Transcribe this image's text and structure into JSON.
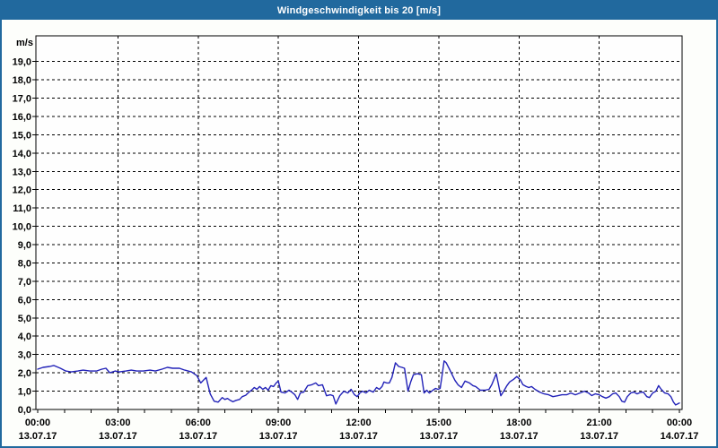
{
  "window": {
    "title_bar": {
      "label": "Windgeschwindigkeit bis 20 [m/s]",
      "bg_color": "#21699e",
      "text_color": "#ffffff"
    },
    "border_color": "#21699e",
    "background_color": "#fdfefb"
  },
  "chart_data": {
    "type": "line",
    "title": "Windgeschwindigkeit bis 20 [m/s]",
    "ylabel": "m/s",
    "ylim": [
      0,
      20.4
    ],
    "grid": "dashed",
    "gridline_color": "#000000",
    "plot_bg": "#fefefe",
    "legend": "none",
    "ytick_labels": [
      "0,0",
      "1,0",
      "2,0",
      "3,0",
      "4,0",
      "5,0",
      "6,0",
      "7,0",
      "8,0",
      "9,0",
      "10,0",
      "11,0",
      "12,0",
      "13,0",
      "14,0",
      "15,0",
      "16,0",
      "17,0",
      "18,0",
      "19,0"
    ],
    "x_axis": {
      "range_hours": [
        0,
        24
      ],
      "minor_tick_hours": 1,
      "major_tick_hours": 3
    },
    "xticks": [
      {
        "hour": 0,
        "time": "00:00",
        "date": "13.07.17"
      },
      {
        "hour": 3,
        "time": "03:00",
        "date": "13.07.17"
      },
      {
        "hour": 6,
        "time": "06:00",
        "date": "13.07.17"
      },
      {
        "hour": 9,
        "time": "09:00",
        "date": "13.07.17"
      },
      {
        "hour": 12,
        "time": "12:00",
        "date": "13.07.17"
      },
      {
        "hour": 15,
        "time": "15:00",
        "date": "13.07.17"
      },
      {
        "hour": 18,
        "time": "18:00",
        "date": "13.07.17"
      },
      {
        "hour": 21,
        "time": "21:00",
        "date": "13.07.17"
      },
      {
        "hour": 24,
        "time": "00:00",
        "date": "14.07.17"
      }
    ],
    "series": [
      {
        "name": "Windgeschwindigkeit",
        "unit": "m/s",
        "color": "#2222b8",
        "points": [
          [
            0.0,
            2.2
          ],
          [
            0.2,
            2.3
          ],
          [
            0.45,
            2.35
          ],
          [
            0.6,
            2.4
          ],
          [
            0.85,
            2.25
          ],
          [
            1.05,
            2.1
          ],
          [
            1.25,
            2.05
          ],
          [
            1.5,
            2.1
          ],
          [
            1.7,
            2.15
          ],
          [
            1.95,
            2.1
          ],
          [
            2.2,
            2.1
          ],
          [
            2.4,
            2.2
          ],
          [
            2.55,
            2.25
          ],
          [
            2.7,
            2.0
          ],
          [
            2.9,
            2.1
          ],
          [
            3.05,
            2.05
          ],
          [
            3.3,
            2.1
          ],
          [
            3.5,
            2.15
          ],
          [
            3.7,
            2.1
          ],
          [
            3.95,
            2.1
          ],
          [
            4.2,
            2.15
          ],
          [
            4.4,
            2.1
          ],
          [
            4.65,
            2.2
          ],
          [
            4.85,
            2.3
          ],
          [
            5.05,
            2.25
          ],
          [
            5.3,
            2.25
          ],
          [
            5.5,
            2.15
          ],
          [
            5.75,
            2.05
          ],
          [
            5.95,
            1.85
          ],
          [
            6.1,
            1.45
          ],
          [
            6.3,
            1.75
          ],
          [
            6.45,
            0.85
          ],
          [
            6.6,
            0.45
          ],
          [
            6.75,
            0.4
          ],
          [
            6.9,
            0.65
          ],
          [
            7.0,
            0.55
          ],
          [
            7.1,
            0.6
          ],
          [
            7.2,
            0.5
          ],
          [
            7.3,
            0.42
          ],
          [
            7.42,
            0.5
          ],
          [
            7.55,
            0.55
          ],
          [
            7.65,
            0.7
          ],
          [
            7.78,
            0.78
          ],
          [
            7.9,
            0.95
          ],
          [
            8.0,
            1.05
          ],
          [
            8.1,
            1.2
          ],
          [
            8.2,
            1.1
          ],
          [
            8.3,
            1.25
          ],
          [
            8.42,
            1.1
          ],
          [
            8.52,
            1.2
          ],
          [
            8.62,
            1.05
          ],
          [
            8.72,
            1.3
          ],
          [
            8.82,
            1.25
          ],
          [
            8.92,
            1.45
          ],
          [
            9.0,
            1.55
          ],
          [
            9.1,
            0.95
          ],
          [
            9.25,
            0.9
          ],
          [
            9.4,
            1.05
          ],
          [
            9.5,
            0.95
          ],
          [
            9.62,
            0.8
          ],
          [
            9.72,
            0.55
          ],
          [
            9.82,
            0.9
          ],
          [
            9.95,
            0.95
          ],
          [
            10.1,
            1.3
          ],
          [
            10.25,
            1.35
          ],
          [
            10.4,
            1.45
          ],
          [
            10.5,
            1.3
          ],
          [
            10.65,
            1.35
          ],
          [
            10.8,
            0.75
          ],
          [
            10.95,
            0.8
          ],
          [
            11.05,
            0.75
          ],
          [
            11.15,
            0.3
          ],
          [
            11.3,
            0.75
          ],
          [
            11.45,
            1.0
          ],
          [
            11.6,
            0.9
          ],
          [
            11.72,
            1.1
          ],
          [
            11.85,
            0.8
          ],
          [
            11.95,
            0.7
          ],
          [
            12.05,
            0.9
          ],
          [
            12.15,
            1.0
          ],
          [
            12.28,
            0.9
          ],
          [
            12.4,
            1.05
          ],
          [
            12.55,
            0.95
          ],
          [
            12.67,
            1.2
          ],
          [
            12.78,
            1.1
          ],
          [
            12.88,
            1.25
          ],
          [
            12.95,
            1.5
          ],
          [
            13.05,
            1.45
          ],
          [
            13.15,
            1.45
          ],
          [
            13.25,
            1.75
          ],
          [
            13.38,
            2.55
          ],
          [
            13.5,
            2.35
          ],
          [
            13.62,
            2.3
          ],
          [
            13.72,
            2.25
          ],
          [
            13.85,
            1.0
          ],
          [
            13.95,
            1.5
          ],
          [
            14.05,
            1.9
          ],
          [
            14.2,
            1.95
          ],
          [
            14.35,
            1.9
          ],
          [
            14.45,
            0.9
          ],
          [
            14.55,
            1.05
          ],
          [
            14.65,
            0.9
          ],
          [
            14.78,
            1.05
          ],
          [
            14.88,
            1.15
          ],
          [
            14.97,
            1.1
          ],
          [
            15.05,
            1.15
          ],
          [
            15.12,
            1.8
          ],
          [
            15.2,
            2.65
          ],
          [
            15.28,
            2.55
          ],
          [
            15.4,
            2.2
          ],
          [
            15.5,
            1.9
          ],
          [
            15.6,
            1.6
          ],
          [
            15.72,
            1.35
          ],
          [
            15.85,
            1.2
          ],
          [
            15.98,
            1.55
          ],
          [
            16.15,
            1.45
          ],
          [
            16.28,
            1.3
          ],
          [
            16.38,
            1.25
          ],
          [
            16.55,
            1.05
          ],
          [
            16.72,
            1.05
          ],
          [
            16.88,
            1.1
          ],
          [
            16.98,
            1.35
          ],
          [
            17.15,
            1.95
          ],
          [
            17.32,
            0.75
          ],
          [
            17.45,
            1.05
          ],
          [
            17.55,
            1.3
          ],
          [
            17.65,
            1.5
          ],
          [
            17.8,
            1.65
          ],
          [
            17.92,
            1.8
          ],
          [
            18.06,
            1.6
          ],
          [
            18.15,
            1.35
          ],
          [
            18.27,
            1.25
          ],
          [
            18.37,
            1.2
          ],
          [
            18.47,
            1.25
          ],
          [
            18.6,
            1.1
          ],
          [
            18.77,
            0.95
          ],
          [
            18.94,
            0.85
          ],
          [
            19.11,
            0.8
          ],
          [
            19.27,
            0.7
          ],
          [
            19.44,
            0.75
          ],
          [
            19.61,
            0.8
          ],
          [
            19.78,
            0.8
          ],
          [
            19.94,
            0.9
          ],
          [
            20.11,
            0.8
          ],
          [
            20.28,
            0.9
          ],
          [
            20.45,
            1.0
          ],
          [
            20.6,
            0.9
          ],
          [
            20.72,
            0.76
          ],
          [
            20.85,
            0.85
          ],
          [
            21.0,
            0.8
          ],
          [
            21.12,
            0.7
          ],
          [
            21.25,
            0.62
          ],
          [
            21.38,
            0.7
          ],
          [
            21.5,
            0.85
          ],
          [
            21.62,
            0.9
          ],
          [
            21.75,
            0.7
          ],
          [
            21.85,
            0.45
          ],
          [
            21.95,
            0.4
          ],
          [
            22.05,
            0.7
          ],
          [
            22.18,
            0.9
          ],
          [
            22.3,
            0.95
          ],
          [
            22.42,
            0.85
          ],
          [
            22.52,
            0.92
          ],
          [
            22.65,
            0.95
          ],
          [
            22.78,
            0.7
          ],
          [
            22.88,
            0.65
          ],
          [
            23.0,
            0.9
          ],
          [
            23.12,
            1.0
          ],
          [
            23.22,
            1.3
          ],
          [
            23.32,
            1.1
          ],
          [
            23.45,
            0.9
          ],
          [
            23.58,
            0.85
          ],
          [
            23.68,
            0.7
          ],
          [
            23.78,
            0.4
          ],
          [
            23.86,
            0.25
          ],
          [
            23.93,
            0.3
          ],
          [
            24.0,
            0.35
          ]
        ]
      }
    ]
  }
}
